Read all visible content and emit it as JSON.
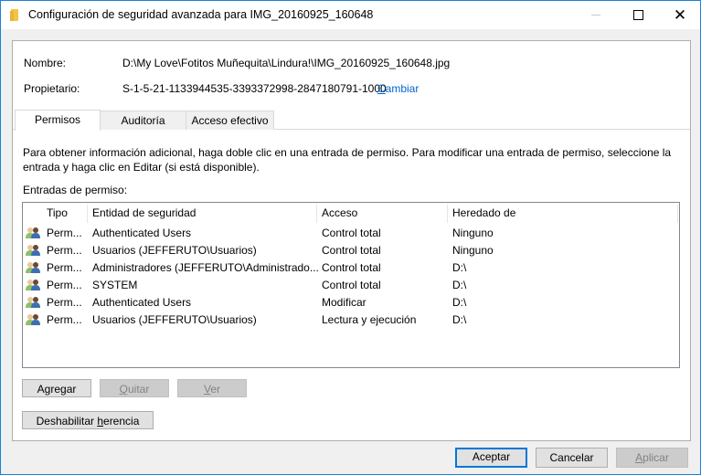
{
  "window": {
    "title": "Configuración de seguridad avanzada para IMG_20160925_160648",
    "controls": {
      "minimize": "—",
      "maximize": "☐",
      "close": "✕"
    }
  },
  "info": {
    "name_label": "Nombre:",
    "name_value": "D:\\My Love\\Fotitos Muñequita\\Lindura!\\IMG_20160925_160648.jpg",
    "owner_label": "Propietario:",
    "owner_value": "S-1-5-21-1133944535-3393372998-2847180791-1000",
    "change_link_first": "C",
    "change_link_rest": "ambiar"
  },
  "tabs": [
    {
      "label": "Permisos",
      "active": true
    },
    {
      "label": "Auditoría",
      "active": false
    },
    {
      "label": "Acceso efectivo",
      "active": false
    }
  ],
  "description": "Para obtener información adicional, haga doble clic en una entrada de permiso. Para modificar una entrada de permiso, seleccione la entrada y haga clic en Editar (si está disponible).",
  "entries_label": "Entradas de permiso:",
  "table": {
    "columns": [
      "Tipo",
      "Entidad de seguridad",
      "Acceso",
      "Heredado de"
    ],
    "rows": [
      {
        "icon": "users-icon",
        "type": "Perm...",
        "principal": "Authenticated Users",
        "access": "Control total",
        "inherited": "Ninguno"
      },
      {
        "icon": "users-icon",
        "type": "Perm...",
        "principal": "Usuarios (JEFFERUTO\\Usuarios)",
        "access": "Control total",
        "inherited": "Ninguno"
      },
      {
        "icon": "users-icon",
        "type": "Perm...",
        "principal": "Administradores (JEFFERUTO\\Administrado...",
        "access": "Control total",
        "inherited": "D:\\"
      },
      {
        "icon": "users-icon",
        "type": "Perm...",
        "principal": "SYSTEM",
        "access": "Control total",
        "inherited": "D:\\"
      },
      {
        "icon": "users-icon",
        "type": "Perm...",
        "principal": "Authenticated Users",
        "access": "Modificar",
        "inherited": "D:\\"
      },
      {
        "icon": "users-icon",
        "type": "Perm...",
        "principal": "Usuarios (JEFFERUTO\\Usuarios)",
        "access": "Lectura y ejecución",
        "inherited": "D:\\"
      }
    ]
  },
  "buttons": {
    "add": {
      "pre": "A",
      "ul": "g",
      "post": "regar"
    },
    "remove": {
      "pre": "",
      "ul": "Q",
      "post": "uitar"
    },
    "view": {
      "pre": "",
      "ul": "V",
      "post": "er"
    },
    "disable_inheritance": {
      "pre": "Deshabilitar ",
      "ul": "h",
      "post": "erencia"
    },
    "ok": "Aceptar",
    "cancel": "Cancelar",
    "apply": {
      "pre": "",
      "ul": "A",
      "post": "plicar"
    }
  },
  "colors": {
    "accent": "#0078d7",
    "link": "#0066cc",
    "window_border": "#1883d7"
  }
}
